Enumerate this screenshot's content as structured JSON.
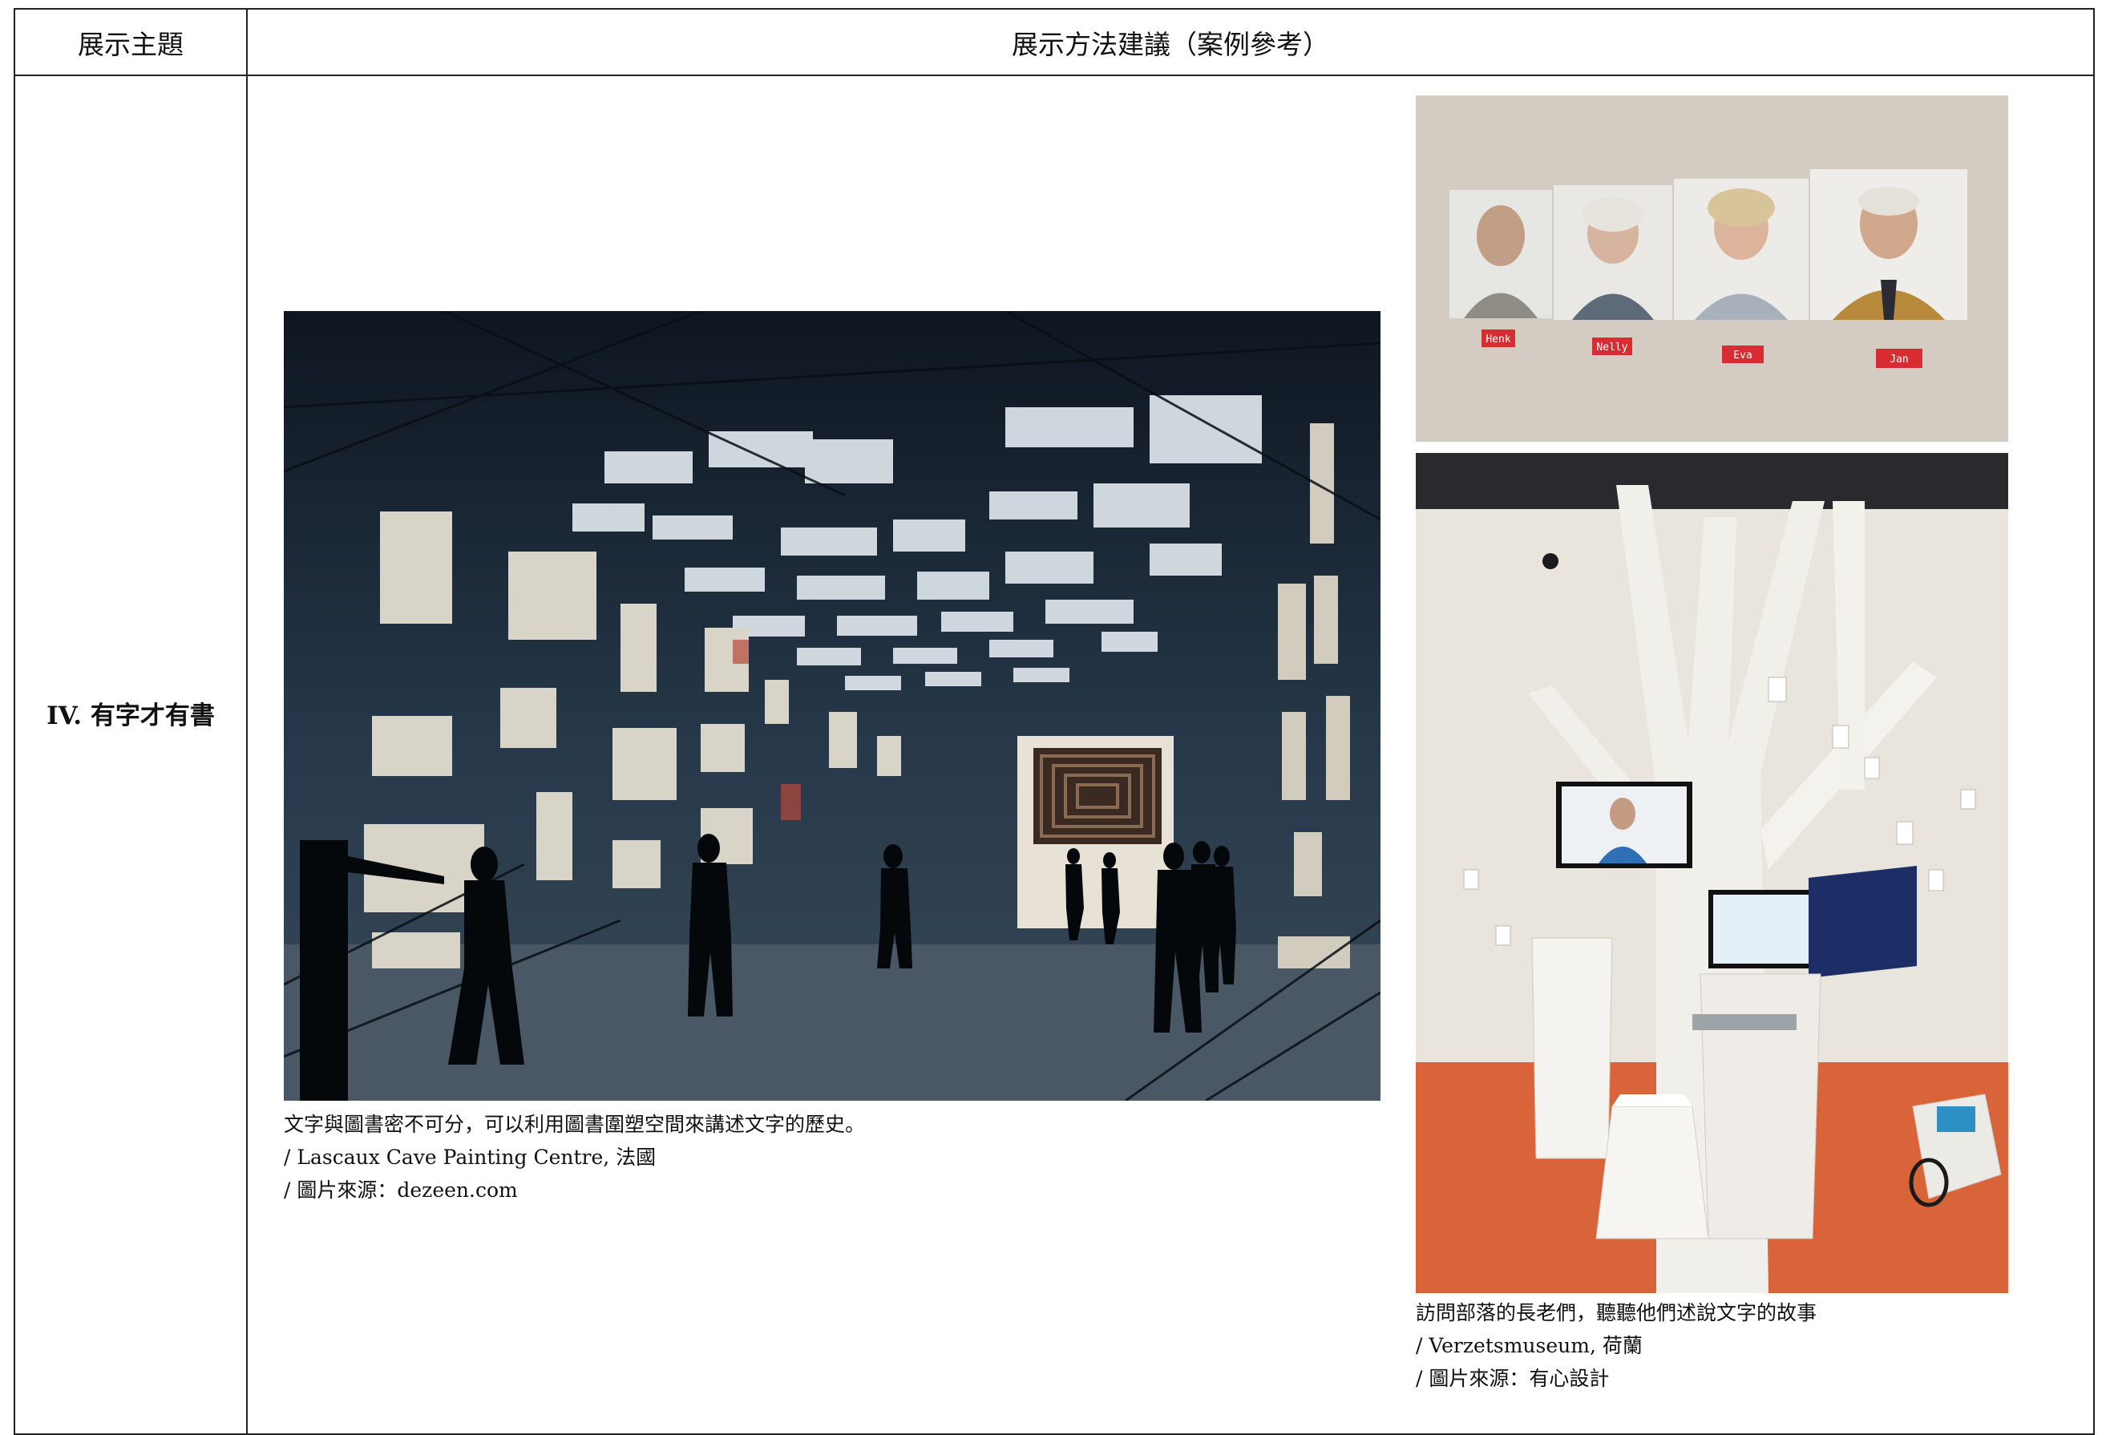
{
  "table": {
    "header_theme": "展示主題",
    "header_method": "展示方法建議（案例參考）",
    "row_theme": "IV. 有字才有書"
  },
  "cases": [
    {
      "caption_lines": [
        "文字與圖書密不可分，可以利用圖書圍塑空間來講述文字的歷史。",
        "/ Lascaux Cave Painting Centre, 法國",
        "/ 圖片來源：dezeen.com"
      ]
    },
    {
      "portrait_names": [
        "Henk",
        "Nelly",
        "Eva",
        "Jan"
      ],
      "caption_lines": [
        "訪問部落的長老們，聽聽他們述說文字的故事",
        "/ Verzetsmuseum, 荷蘭",
        "/ 圖片來源：有心設計"
      ]
    }
  ],
  "colors": {
    "border": "#222222",
    "cave_dark": "#1a2530",
    "floor_orange": "#d9643a",
    "name_tag_red": "#d82b32"
  }
}
